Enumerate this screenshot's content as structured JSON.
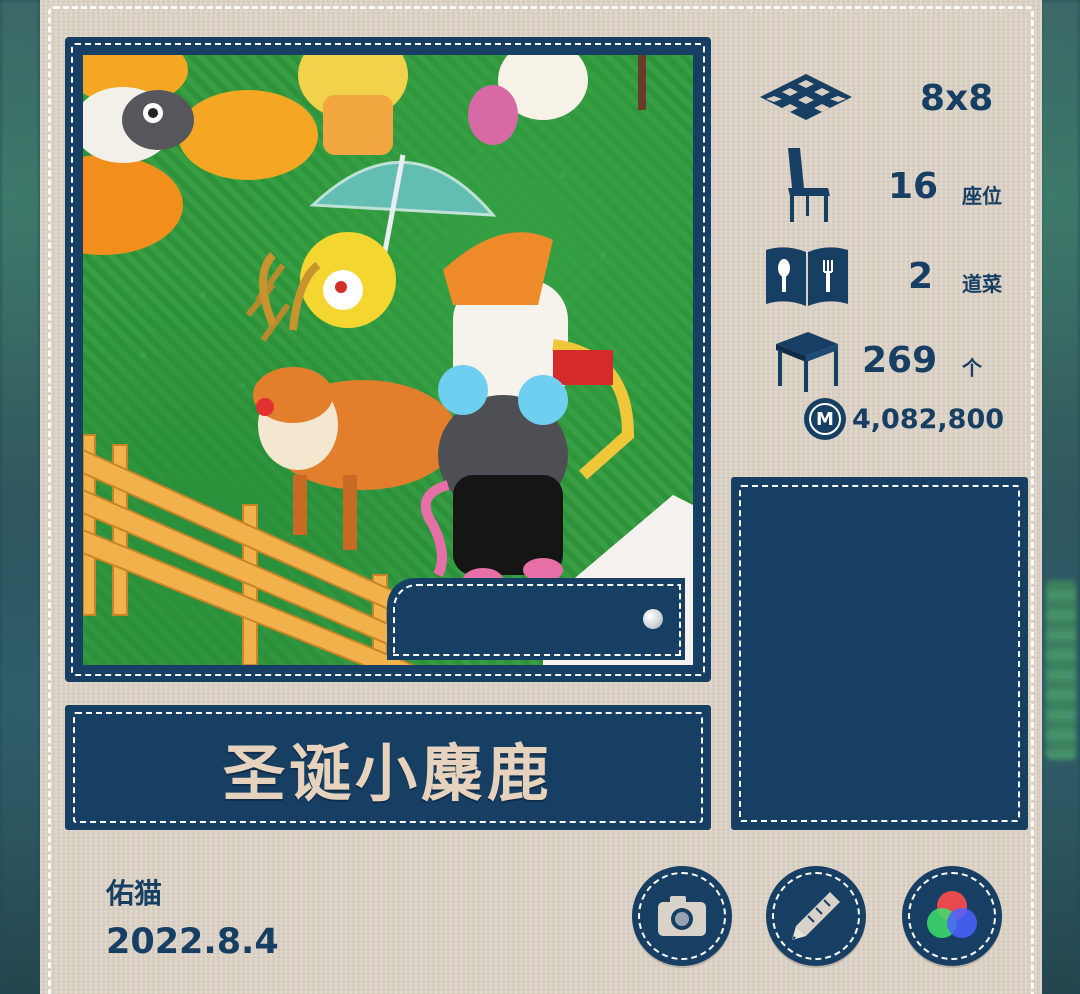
{
  "card": {
    "title": "圣诞小麋鹿",
    "author": "佑猫",
    "date": "2022.8.4"
  },
  "stats": {
    "grid_size": "8x8",
    "seats": "16",
    "seats_unit": "座位",
    "dishes": "2",
    "dishes_unit": "道菜",
    "furniture": "269",
    "furniture_unit": "个",
    "money_symbol": "M",
    "money": "4,082,800"
  },
  "icons": {
    "grid": "checkered-floor-icon",
    "seats": "chair-icon",
    "dishes": "menu-book-icon",
    "furniture": "table-icon",
    "money": "coin-icon",
    "camera": "camera-icon",
    "edit": "pencil-icon",
    "color": "rgb-color-icon"
  },
  "colors": {
    "navy": "#173f63",
    "card": "#d9cfc2",
    "title_text": "#e6d2bd"
  }
}
